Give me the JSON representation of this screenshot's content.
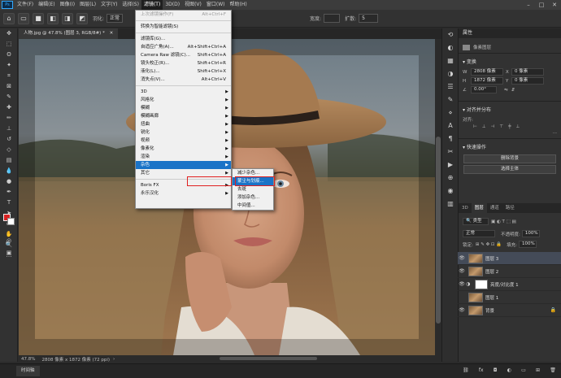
{
  "app": {
    "logo": "Ps"
  },
  "menubar": {
    "items": [
      "文件(F)",
      "编辑(E)",
      "图像(I)",
      "图层(L)",
      "文字(Y)",
      "选择(S)",
      "滤镜(T)",
      "3D(D)",
      "视图(V)",
      "窗口(W)",
      "帮助(H)"
    ],
    "active_index": 6
  },
  "optbar": {
    "style_label": "羽化:",
    "mode_value": "正常",
    "width_label": "宽度:",
    "spread_label": "扩散:",
    "spread_value": "5"
  },
  "document": {
    "tab_label": "人物.jpg @ 47.8% (图层 3, RGB/8#) *",
    "zoom": "47.8%",
    "size_info": "2808 像素 x 1872 像素 (72 ppi)"
  },
  "filter_menu": {
    "groups": [
      [
        {
          "label": "上次滤镜操作(F)",
          "shortcut": "Alt+Ctrl+F",
          "disabled": true
        }
      ],
      [
        {
          "label": "转换为智能滤镜(S)",
          "shortcut": ""
        }
      ],
      [
        {
          "label": "滤镜库(G)...",
          "shortcut": ""
        },
        {
          "label": "自适应广角(A)...",
          "shortcut": "Alt+Shift+Ctrl+A"
        },
        {
          "label": "Camera Raw 滤镜(C)...",
          "shortcut": "Shift+Ctrl+A"
        },
        {
          "label": "镜头校正(R)...",
          "shortcut": "Shift+Ctrl+R"
        },
        {
          "label": "液化(L)...",
          "shortcut": "Shift+Ctrl+X"
        },
        {
          "label": "消失点(V)...",
          "shortcut": "Alt+Ctrl+V"
        }
      ],
      [
        {
          "label": "3D",
          "submenu": true
        },
        {
          "label": "风格化",
          "submenu": true
        },
        {
          "label": "模糊",
          "submenu": true
        },
        {
          "label": "模糊画廊",
          "submenu": true
        },
        {
          "label": "扭曲",
          "submenu": true
        },
        {
          "label": "锐化",
          "submenu": true
        },
        {
          "label": "视频",
          "submenu": true
        },
        {
          "label": "像素化",
          "submenu": true
        },
        {
          "label": "渲染",
          "submenu": true
        },
        {
          "label": "杂色",
          "submenu": true,
          "highlighted": true
        },
        {
          "label": "其它",
          "submenu": true
        }
      ],
      [
        {
          "label": "Boris FX",
          "submenu": true
        },
        {
          "label": "永乐汉化",
          "submenu": true
        }
      ]
    ]
  },
  "noise_submenu": {
    "items": [
      "减少杂色...",
      "蒙尘与划痕...",
      "去斑",
      "添加杂色...",
      "中间值..."
    ],
    "highlighted_index": 1
  },
  "properties": {
    "tab": "属性",
    "type_label": "像素图层",
    "transform_title": "变换",
    "w_label": "W",
    "w_value": "2808 像素",
    "x_label": "X",
    "x_value": "0 像素",
    "h_label": "H",
    "h_value": "1872 像素",
    "y_label": "Y",
    "y_value": "0 像素",
    "angle_value": "0.00°",
    "align_title": "对齐并分布",
    "align_label": "对齐:",
    "quick_title": "快速操作",
    "remove_bg": "删除背景",
    "select_subject": "选择主体"
  },
  "layers": {
    "tabs": [
      "3D",
      "图层",
      "通道",
      "路径"
    ],
    "filter_label": "类型",
    "blend_mode": "正常",
    "opacity_label": "不透明度:",
    "opacity_value": "100%",
    "lock_label": "锁定:",
    "fill_label": "填充:",
    "fill_value": "100%",
    "items": [
      {
        "name": "图层 3",
        "selected": true
      },
      {
        "name": "图层 2",
        "selected": false
      },
      {
        "name": "亮度/对比度 1",
        "selected": false,
        "adjustment": true
      },
      {
        "name": "图层 1",
        "selected": false
      },
      {
        "name": "背景",
        "selected": false
      }
    ]
  },
  "timeline": {
    "label": "时间轴"
  },
  "colors": {
    "menu_highlight": "#1a73c7",
    "annotation_red": "#e02020",
    "foreground": "#d82222",
    "background": "#ffffff"
  }
}
